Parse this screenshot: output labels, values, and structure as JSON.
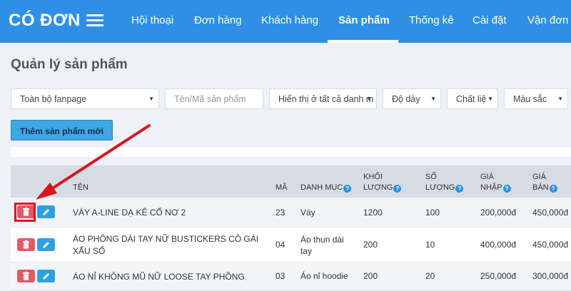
{
  "app": {
    "logo": "CÓ ĐƠN"
  },
  "nav": {
    "items": [
      {
        "key": "hoi-thoai",
        "label": "Hội thoại"
      },
      {
        "key": "don-hang",
        "label": "Đơn hàng"
      },
      {
        "key": "khach-hang",
        "label": "Khách hàng"
      },
      {
        "key": "san-pham",
        "label": "Sản phẩm",
        "active": true
      },
      {
        "key": "thong-ke",
        "label": "Thống kê"
      },
      {
        "key": "cai-dat",
        "label": "Cài đặt"
      },
      {
        "key": "van-don",
        "label": "Vận đơn"
      }
    ]
  },
  "page": {
    "title": "Quản lý sản phẩm"
  },
  "filters": {
    "fanpage": "Toàn bộ fanpage",
    "search_placeholder": "Tên/Mã sản phẩm",
    "category": "Hiển thị ở tất cả danh m",
    "thickness": "Độ dày",
    "material": "Chất liệ",
    "color": "Màu sắc"
  },
  "actions": {
    "add_product": "Thêm sản phẩm mới"
  },
  "table": {
    "headers": {
      "name": "Tên",
      "code": "Mã",
      "category": "Danh mục",
      "weight_1": "Khối",
      "weight_2": "lượng",
      "qty_1": "Số",
      "qty_2": "lượng",
      "cost_1": "Giá",
      "cost_2": "nhập",
      "price_1": "Giá",
      "price_2": "bán"
    },
    "rows": [
      {
        "name": "VÁY A-LINE DẠ KÊ CỔ NƠ 2",
        "code": "23",
        "category": "Váy",
        "weight": "1200",
        "qty": "100",
        "cost": "200,000đ",
        "price": "450,000đ"
      },
      {
        "name": "ÁO PHÔNG DÀI TAY NỮ BUSTICKERS CÔ GÁI XẤU SỐ",
        "code": "04",
        "category": "Áo thun dài tay",
        "weight": "200",
        "qty": "10",
        "cost": "400,000đ",
        "price": "450,000đ"
      },
      {
        "name": "ÁO NỈ KHÔNG MŨ NỮ LOOSE TAY PHỒNG",
        "code": "03",
        "category": "Áo nỉ hoodie",
        "weight": "200",
        "qty": "20",
        "cost": "250,000đ",
        "price": "300,000đ"
      }
    ]
  },
  "colors": {
    "brand": "#2f8fe6",
    "delete": "#e25a66",
    "edit": "#2da0e6",
    "annotation": "#e3121b"
  },
  "icons": [
    "hamburger-icon",
    "caret-down-icon",
    "info-icon",
    "trash-icon",
    "pencil-icon",
    "arrow-annotation"
  ]
}
